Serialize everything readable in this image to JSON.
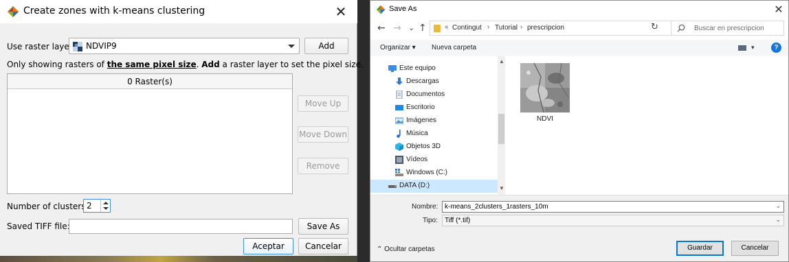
{
  "kmeans_dialog": {
    "title": "Create zones with k-means clustering",
    "close_symbol": "✕",
    "raster_layer_label": "Use raster layer",
    "raster_layer_value": "NDVIP9",
    "add_label": "Add",
    "info_prefix": "Only showing rasters of ",
    "info_emphasis": "the same pixel size",
    "info_mid": ". ",
    "info_add": "Add",
    "info_suffix": " a raster layer to set the pixel size.",
    "raster_list_header": "0 Raster(s)",
    "move_up_label": "Move Up",
    "move_down_label": "Move Down",
    "remove_label": "Remove",
    "clusters_label": "Number of clusters:",
    "clusters_value": "2",
    "tiff_label": "Saved TIFF file:",
    "tiff_value": "",
    "save_as_label": "Save As",
    "accept_label": "Aceptar",
    "cancel_label": "Cancelar"
  },
  "saveas_dialog": {
    "title": "Save As",
    "close_symbol": "✕",
    "nav_back": "←",
    "nav_forward": "→",
    "nav_recent": "⌄",
    "nav_up": "↑",
    "path_overflow": "«",
    "breadcrumbs": [
      "Contingut",
      "Tutorial",
      "prescripcion"
    ],
    "crumb_separator": "›",
    "path_dropdown": "⌄",
    "refresh_symbol": "↻",
    "search_placeholder": "Buscar en prescripcion",
    "organize_label": "Organizar ▾",
    "new_folder_label": "Nueva carpeta",
    "view_dropdown": "▾",
    "help_symbol": "?",
    "tree": [
      {
        "label": "Este equipo",
        "icon": "computer-icon",
        "color": "#3a8ee6"
      },
      {
        "label": "Descargas",
        "icon": "download-icon",
        "color": "#2b78d6"
      },
      {
        "label": "Documentos",
        "icon": "document-icon",
        "color": "#7f8ea3"
      },
      {
        "label": "Escritorio",
        "icon": "desktop-icon",
        "color": "#1e88e5"
      },
      {
        "label": "Imágenes",
        "icon": "pictures-icon",
        "color": "#4a90c8"
      },
      {
        "label": "Música",
        "icon": "music-icon",
        "color": "#1e6bd6"
      },
      {
        "label": "Objetos 3D",
        "icon": "objects-3d-icon",
        "color": "#2bb5e8"
      },
      {
        "label": "Vídeos",
        "icon": "videos-icon",
        "color": "#4b5563"
      },
      {
        "label": "Windows (C:)",
        "icon": "windows-drive-icon",
        "color": "#2b78d6"
      },
      {
        "label": "DATA (D:)",
        "icon": "drive-icon",
        "color": "#606060"
      }
    ],
    "selected_tree_item": "DATA (D:)",
    "scroll_up": "▲",
    "scroll_down": "▼",
    "file_name": "NDVI",
    "filename_label": "Nombre:",
    "filename_value": "k-means_2clusters_1rasters_10m",
    "filetype_label": "Tipo:",
    "filetype_value": "Tiff (*.tif)",
    "field_dropdown": "⌄",
    "hide_folders_label": "⌃  Ocultar carpetas",
    "save_label": "Guardar",
    "cancel_label": "Cancelar"
  },
  "colors": {
    "accent_blue": "#0078d7",
    "selection": "#cce8ff",
    "folder_yellow": "#e8b93a"
  }
}
